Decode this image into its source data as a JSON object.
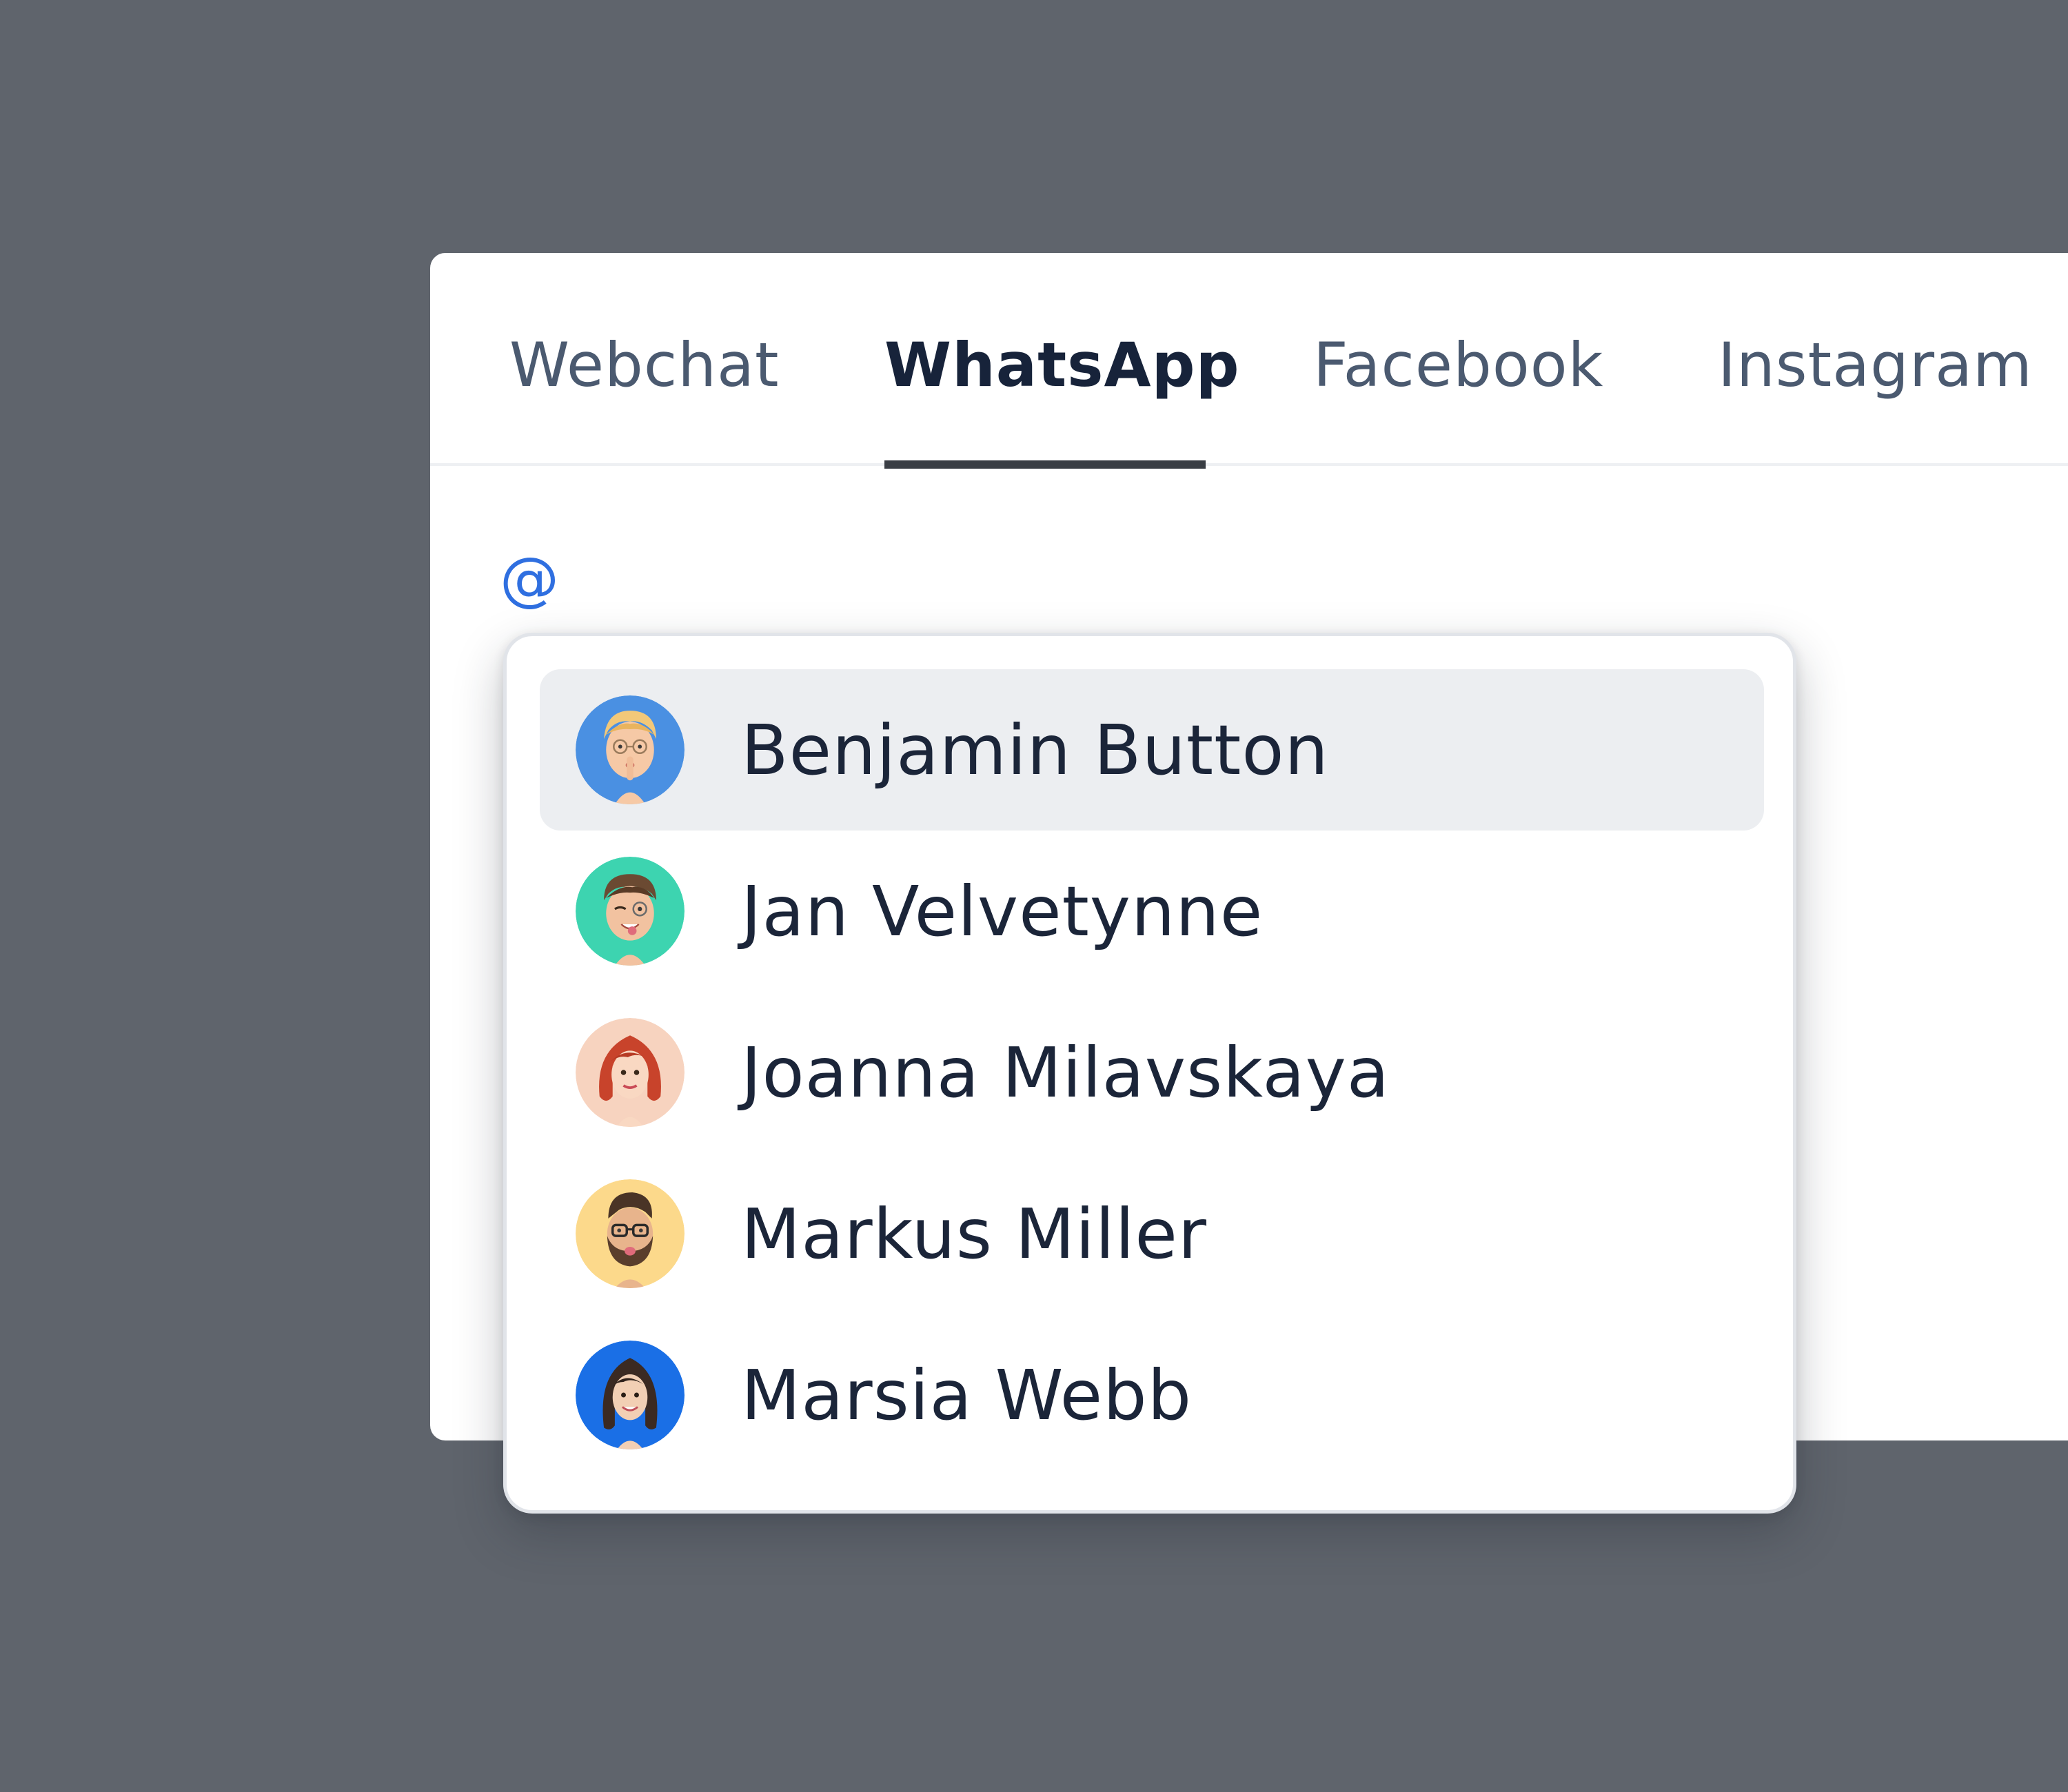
{
  "tabs": [
    {
      "label": "Webchat",
      "active": false
    },
    {
      "label": "WhatsApp",
      "active": true
    },
    {
      "label": "Facebook",
      "active": false
    },
    {
      "label": "Instagram",
      "active": false
    }
  ],
  "composer": {
    "trigger": "@"
  },
  "mention_list": {
    "highlighted_index": 0,
    "items": [
      {
        "name": "Benjamin Button",
        "avatar_bg": "#4a90e2",
        "avatar": "memoji-blond-glasses-shush"
      },
      {
        "name": "Jan Velvetynne",
        "avatar_bg": "#3dd4b0",
        "avatar": "memoji-brown-hair-wink"
      },
      {
        "name": "Joanna Milavskaya",
        "avatar_bg": "#f7d3bf",
        "avatar": "memoji-red-hair-woman"
      },
      {
        "name": "Markus Miller",
        "avatar_bg": "#fcd98b",
        "avatar": "memoji-beard-glasses"
      },
      {
        "name": "Marsia Webb",
        "avatar_bg": "#1a6fe6",
        "avatar": "memoji-dark-hair-woman"
      }
    ]
  },
  "colors": {
    "backdrop": "#5f646c",
    "active_tab_text": "#17233a",
    "inactive_tab_text": "#4b5a70",
    "trigger": "#2f6fe0",
    "highlight": "#eceef1"
  }
}
